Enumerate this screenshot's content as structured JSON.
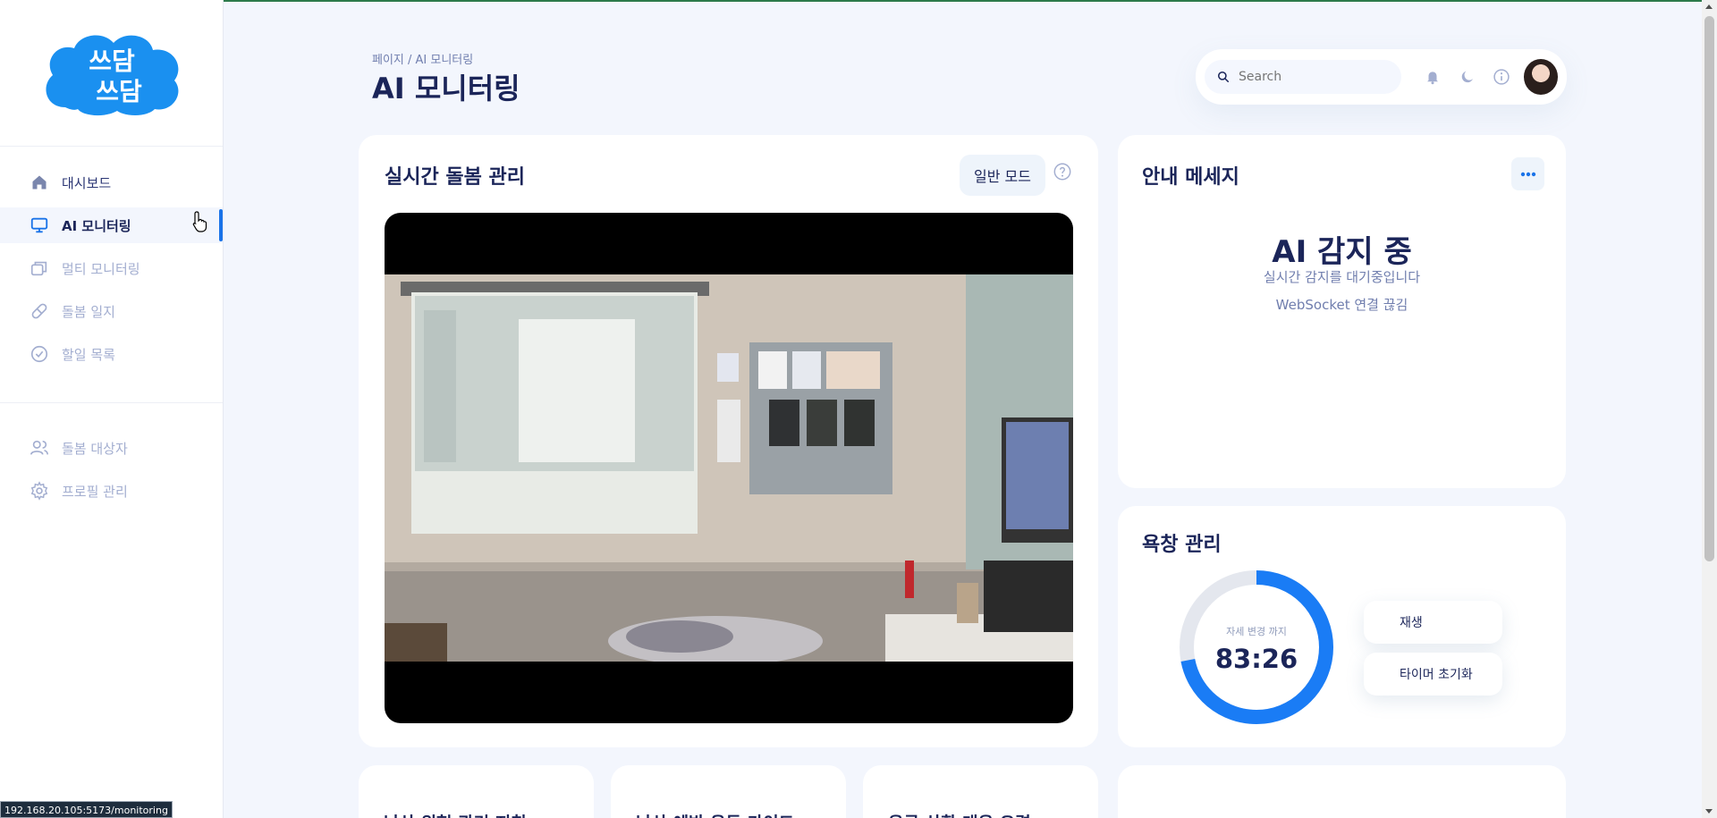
{
  "browser": {
    "status_url": "192.168.20.105:5173/monitoring"
  },
  "brand": {
    "logo_text_top": "쓰담",
    "logo_text_bottom": "쓰담",
    "logo_color": "#1a90f0"
  },
  "sidebar": {
    "items": [
      {
        "label": "대시보드",
        "icon": "home-icon"
      },
      {
        "label": "AI 모니터링",
        "icon": "monitor-icon",
        "active": true
      },
      {
        "label": "멀티 모니터링",
        "icon": "layers-icon"
      },
      {
        "label": "돌봄 일지",
        "icon": "pill-icon"
      },
      {
        "label": "할일 목록",
        "icon": "check-circle-icon"
      },
      {
        "label": "돌봄 대상자",
        "icon": "users-icon"
      },
      {
        "label": "프로필 관리",
        "icon": "gear-icon"
      }
    ]
  },
  "header": {
    "breadcrumb": "페이지 / AI 모니터링",
    "title": "AI 모니터링",
    "search_placeholder": "Search"
  },
  "main_card": {
    "title": "실시간 돌봄 관리",
    "mode_button": "일반 모드",
    "help_icon": "question-circle-icon"
  },
  "message_card": {
    "title": "안내 메세지",
    "status": "AI 감지 중",
    "subtitle": "실시간 감지를 대기중입니다",
    "websocket": "WebSocket 연결 끊김"
  },
  "bath_card": {
    "title": "욕창 관리",
    "timer_label": "자세 변경 까지",
    "timer_value": "83:26",
    "progress_fraction": 0.72,
    "play_button": "재생",
    "reset_button": "타이머 초기화"
  },
  "bottom_cards": [
    {
      "title": "낙상 위험 관리 지침"
    },
    {
      "title": "낙상 예방 운동 가이드"
    },
    {
      "title": "응급 상황 대응 요령"
    },
    {
      "title": ""
    }
  ],
  "colors": {
    "accent": "#1a73e8",
    "text_dark": "#1b2559",
    "text_muted": "#a3aed0",
    "background": "#f3f6fd"
  }
}
